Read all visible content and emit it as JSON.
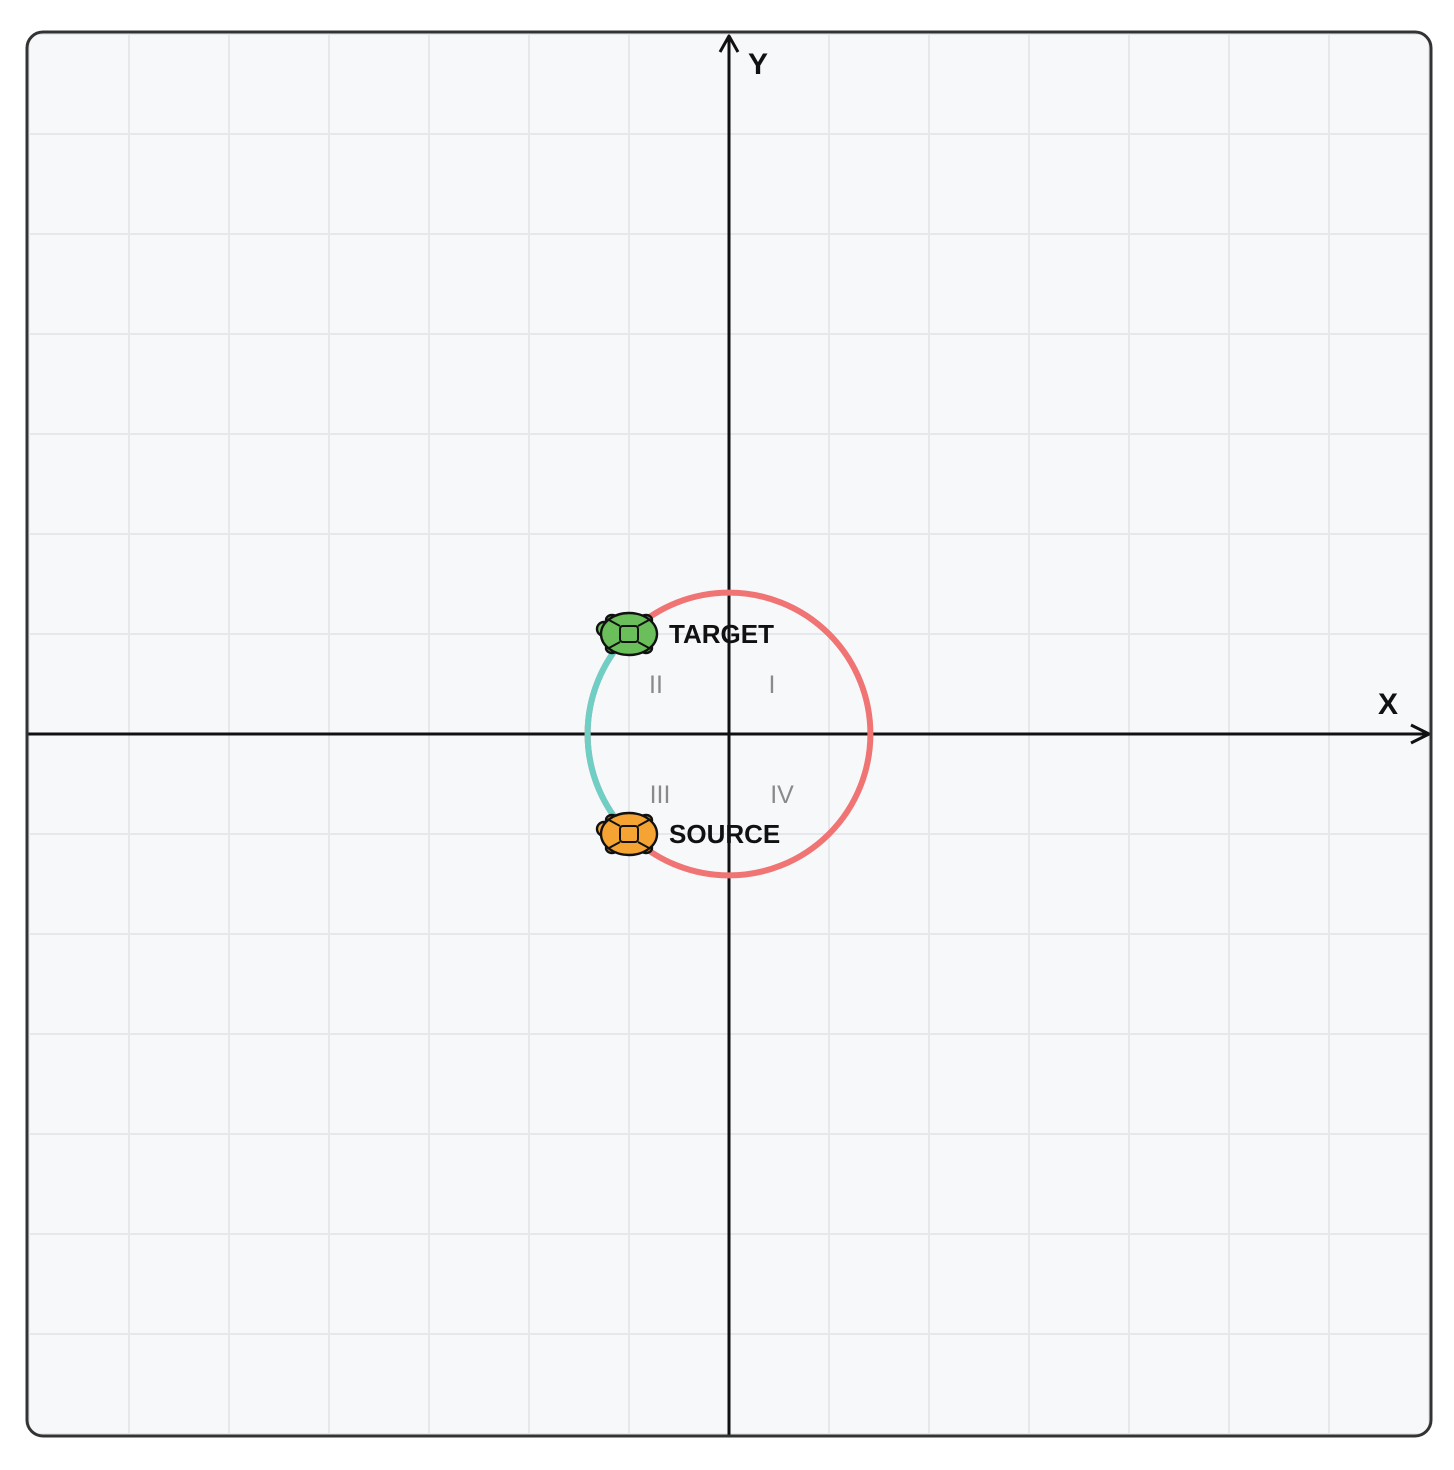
{
  "axes": {
    "x_label": "X",
    "y_label": "Y",
    "range": [
      -7,
      7
    ],
    "grid": true
  },
  "quadrants": {
    "q1": "I",
    "q2": "II",
    "q3": "III",
    "q4": "IV"
  },
  "circle": {
    "center": [
      0,
      0
    ],
    "radius": 1.414,
    "color": "#F07474"
  },
  "arc": {
    "from_angle_deg": 225,
    "to_angle_deg": 135,
    "direction": "clockwise",
    "color": "#6FCFC4"
  },
  "markers": [
    {
      "id": "source",
      "label": "SOURCE",
      "x": -1,
      "y": -1,
      "color": "#F5A433",
      "icon": "turtle-icon"
    },
    {
      "id": "target",
      "label": "TARGET",
      "x": -1,
      "y": 1,
      "color": "#6BBF5B",
      "icon": "turtle-icon"
    }
  ],
  "colors": {
    "background": "#F7F8FA",
    "grid": "#E6E8EC",
    "frame": "#333333",
    "axis": "#111111"
  }
}
